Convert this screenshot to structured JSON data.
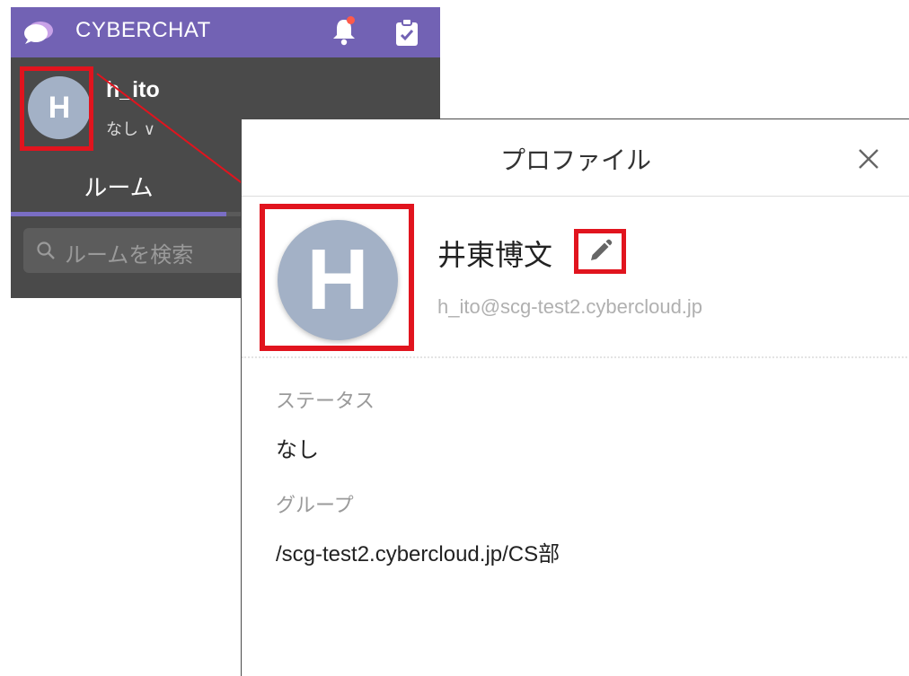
{
  "app": {
    "title": "CYBERCHAT",
    "user": {
      "avatar_initial": "H",
      "name": "h_ito",
      "status": "なし ∨"
    },
    "tabs": [
      {
        "label": "ルーム"
      }
    ],
    "search": {
      "placeholder": "ルームを検索"
    }
  },
  "profile": {
    "title": "プロファイル",
    "avatar_initial": "H",
    "display_name": "井東博文",
    "email": "h_ito@scg-test2.cybercloud.jp",
    "status_label": "ステータス",
    "status_value": "なし",
    "group_label": "グループ",
    "group_value": "/scg-test2.cybercloud.jp/CS部"
  },
  "colors": {
    "header_purple": "#7262b4",
    "sidebar_dark": "#4a4a4a",
    "avatar_bg": "#a3b1c6",
    "highlight_red": "#e1141e",
    "notification_dot": "#ff5a4a"
  },
  "icons": [
    "chat-logo-icon",
    "bell-icon",
    "clipboard-check-icon",
    "user-settings-icon",
    "search-icon",
    "close-icon",
    "pencil-icon"
  ]
}
